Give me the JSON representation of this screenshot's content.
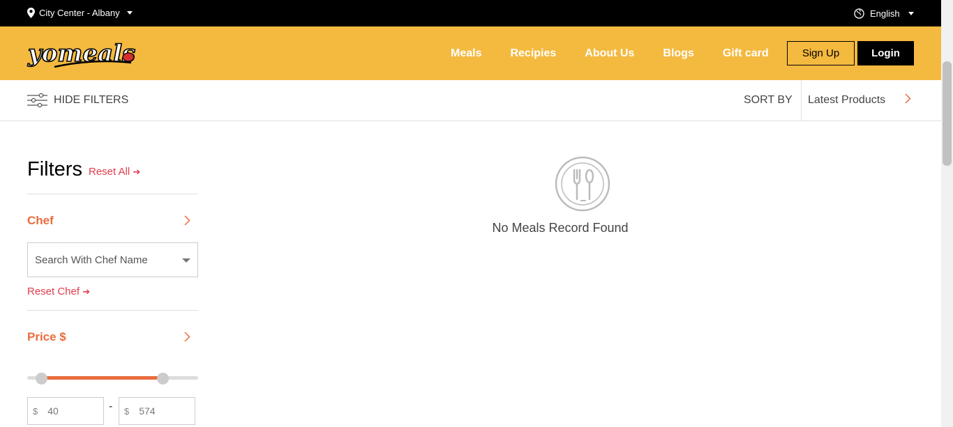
{
  "topbar": {
    "location": "City Center - Albany",
    "language": "English"
  },
  "header": {
    "logo_text": "yomeals",
    "nav": [
      "Meals",
      "Recipies",
      "About Us",
      "Blogs",
      "Gift card"
    ],
    "signup_label": "Sign Up",
    "login_label": "Login"
  },
  "filterbar": {
    "hide_filters_label": "HIDE FILTERS",
    "sort_by_label": "SORT BY",
    "sort_value": "Latest Products"
  },
  "sidebar": {
    "title": "Filters",
    "reset_all_label": "Reset All",
    "chef_title": "Chef",
    "chef_placeholder": "Search With Chef Name",
    "reset_chef_label": "Reset Chef",
    "price_title": "Price $",
    "price_currency": "$",
    "price_min": "40",
    "price_max": "574",
    "price_separator": "-"
  },
  "main": {
    "empty_message": "No Meals Record Found"
  },
  "colors": {
    "header_bg": "#f4b93f",
    "accent": "#e96c3c",
    "reset_red": "#e03b4c"
  }
}
